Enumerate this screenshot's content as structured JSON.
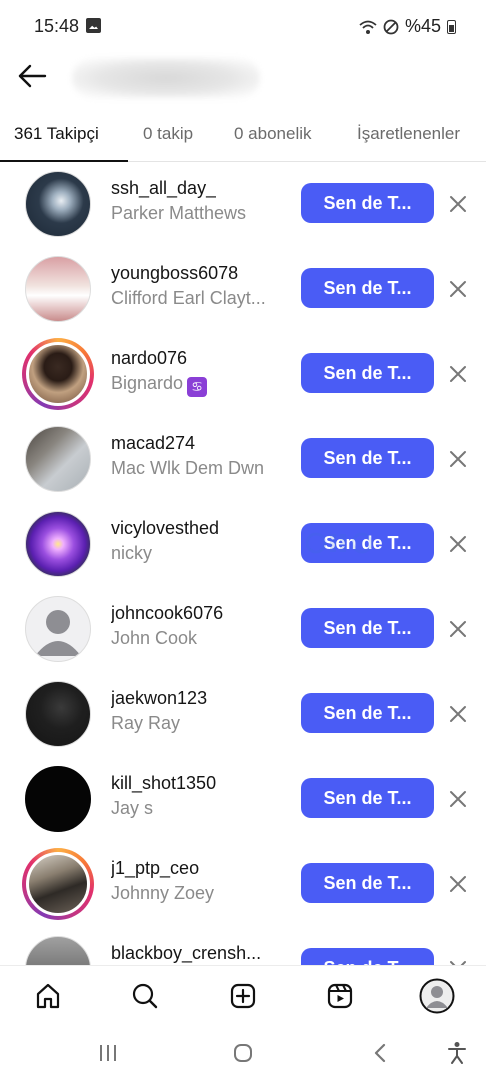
{
  "status_bar": {
    "time": "15:48",
    "battery": "%45",
    "icons": [
      "image-icon",
      "wifi-icon",
      "do-not-disturb-icon",
      "battery-icon"
    ]
  },
  "header": {
    "back_icon": "arrow-left-icon"
  },
  "tabs": [
    {
      "label": "361 Takipçi",
      "active": true
    },
    {
      "label": "0 takip",
      "active": false
    },
    {
      "label": "0 abonelik",
      "active": false
    },
    {
      "label": "İşaretlenenler",
      "active": false
    }
  ],
  "followers": [
    {
      "username": "ssh_all_day_",
      "name": "Parker Matthews",
      "button": "Sen de T...",
      "story": false
    },
    {
      "username": "youngboss6078",
      "name": "Clifford Earl Clayt...",
      "button": "Sen de T...",
      "story": false
    },
    {
      "username": "nardo076",
      "name": "Bignardo",
      "button": "Sen de T...",
      "story": true,
      "emoji": "♋"
    },
    {
      "username": "macad274",
      "name": "Mac Wlk Dem Dwn",
      "button": "Sen de T...",
      "story": false
    },
    {
      "username": "vicylovesthed",
      "name": "nicky",
      "button": "Sen de T...",
      "story": false
    },
    {
      "username": "johncook6076",
      "name": "John Cook",
      "button": "Sen de T...",
      "story": false
    },
    {
      "username": "jaekwon123",
      "name": "Ray Ray",
      "button": "Sen de T...",
      "story": false
    },
    {
      "username": "kill_shot1350",
      "name": "Jay s",
      "button": "Sen de T...",
      "story": false
    },
    {
      "username": "j1_ptp_ceo",
      "name": "Johnny Zoey",
      "button": "Sen de T...",
      "story": true
    },
    {
      "username": "blackboy_crensh...",
      "name": "",
      "button": "Sen de T...",
      "story": false
    }
  ],
  "colors": {
    "follow_button": "#4a5cf5",
    "story_ring": [
      "#fcaf45",
      "#e1306c",
      "#833ab4"
    ]
  },
  "bottom_nav": [
    "home-icon",
    "search-icon",
    "create-icon",
    "reels-icon",
    "profile-avatar"
  ],
  "system_nav": [
    "recents-icon",
    "home-circle-icon",
    "back-chevron-icon",
    "accessibility-icon"
  ]
}
